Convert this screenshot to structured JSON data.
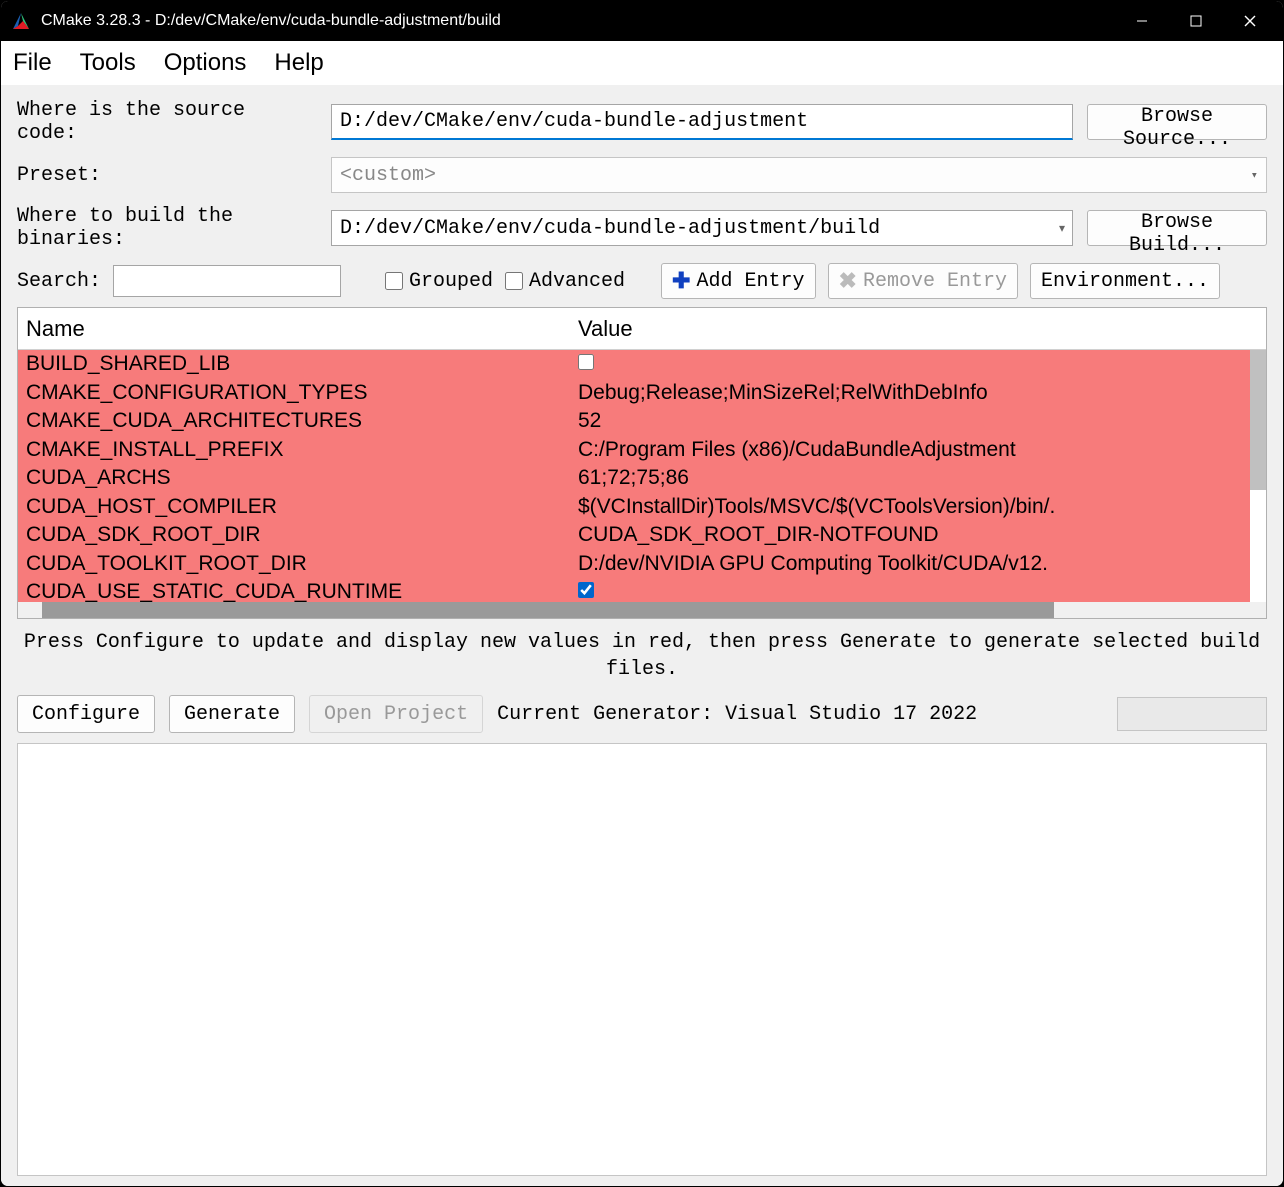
{
  "window": {
    "title": "CMake 3.28.3 - D:/dev/CMake/env/cuda-bundle-adjustment/build"
  },
  "menu": {
    "file": "File",
    "tools": "Tools",
    "options": "Options",
    "help": "Help"
  },
  "config": {
    "source_label": "Where is the source code:",
    "source_value": "D:/dev/CMake/env/cuda-bundle-adjustment",
    "browse_source": "Browse Source...",
    "preset_label": "Preset:",
    "preset_value": "<custom>",
    "build_label": "Where to build the binaries:",
    "build_value": "D:/dev/CMake/env/cuda-bundle-adjustment/build",
    "browse_build": "Browse Build..."
  },
  "toolbar": {
    "search_label": "Search:",
    "search_value": "",
    "grouped": "Grouped",
    "advanced": "Advanced",
    "add_entry": "Add Entry",
    "remove_entry": "Remove Entry",
    "environment": "Environment..."
  },
  "cache": {
    "header_name": "Name",
    "header_value": "Value",
    "rows": [
      {
        "name": "BUILD_SHARED_LIB",
        "value_type": "bool",
        "value": false
      },
      {
        "name": "CMAKE_CONFIGURATION_TYPES",
        "value_type": "text",
        "value": "Debug;Release;MinSizeRel;RelWithDebInfo"
      },
      {
        "name": "CMAKE_CUDA_ARCHITECTURES",
        "value_type": "text",
        "value": "52"
      },
      {
        "name": "CMAKE_INSTALL_PREFIX",
        "value_type": "text",
        "value": "C:/Program Files (x86)/CudaBundleAdjustment"
      },
      {
        "name": "CUDA_ARCHS",
        "value_type": "text",
        "value": "61;72;75;86"
      },
      {
        "name": "CUDA_HOST_COMPILER",
        "value_type": "text",
        "value": "$(VCInstallDir)Tools/MSVC/$(VCToolsVersion)/bin/."
      },
      {
        "name": "CUDA_SDK_ROOT_DIR",
        "value_type": "text",
        "value": "CUDA_SDK_ROOT_DIR-NOTFOUND"
      },
      {
        "name": "CUDA_TOOLKIT_ROOT_DIR",
        "value_type": "text",
        "value": "D:/dev/NVIDIA GPU Computing Toolkit/CUDA/v12."
      },
      {
        "name": "CUDA_USE_STATIC_CUDA_RUNTIME",
        "value_type": "bool",
        "value": true
      }
    ]
  },
  "hint": "Press Configure to update and display new values in red, then press Generate to generate selected build files.",
  "actions": {
    "configure": "Configure",
    "generate": "Generate",
    "open_project": "Open Project",
    "generator_label": "Current Generator: Visual Studio 17 2022"
  }
}
